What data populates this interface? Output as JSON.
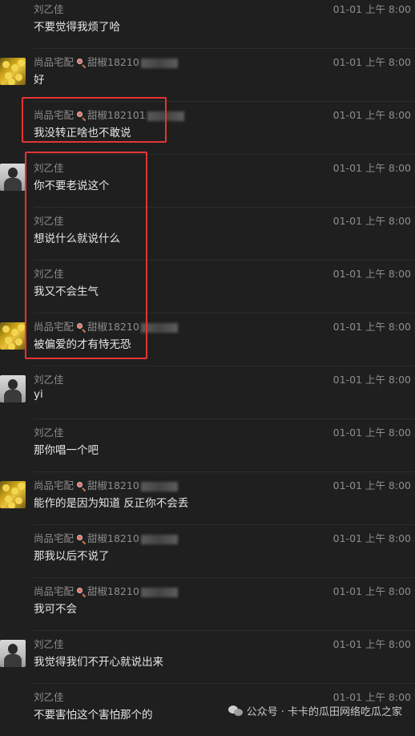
{
  "time_label": "01-01 上午 8:00",
  "messages": [
    {
      "sender": "刘乙佳",
      "sender_suffix": "",
      "text": "不要觉得我烦了哈",
      "avatar": ""
    },
    {
      "sender": "尚品宅配",
      "sender_suffix": "甜椒18210",
      "text": "好",
      "avatar": "flower"
    },
    {
      "sender": "尚品宅配",
      "sender_suffix": "甜椒182101",
      "text": "我没转正啥也不敢说",
      "avatar": ""
    },
    {
      "sender": "刘乙佳",
      "sender_suffix": "",
      "text": "你不要老说这个",
      "avatar": "person"
    },
    {
      "sender": "刘乙佳",
      "sender_suffix": "",
      "text": "想说什么就说什么",
      "avatar": ""
    },
    {
      "sender": "刘乙佳",
      "sender_suffix": "",
      "text": "我又不会生气",
      "avatar": ""
    },
    {
      "sender": "尚品宅配",
      "sender_suffix": "甜椒18210",
      "text": "被偏爱的才有恃无恐",
      "avatar": "flower"
    },
    {
      "sender": "刘乙佳",
      "sender_suffix": "",
      "text": "yi",
      "avatar": "person"
    },
    {
      "sender": "刘乙佳",
      "sender_suffix": "",
      "text": "那你唱一个吧",
      "avatar": ""
    },
    {
      "sender": "尚品宅配",
      "sender_suffix": "甜椒18210",
      "text": "能作的是因为知道 反正你不会丢",
      "avatar": "flower"
    },
    {
      "sender": "尚品宅配",
      "sender_suffix": "甜椒18210",
      "text": "那我以后不说了",
      "avatar": ""
    },
    {
      "sender": "尚品宅配",
      "sender_suffix": "甜椒18210",
      "text": "我可不会",
      "avatar": ""
    },
    {
      "sender": "刘乙佳",
      "sender_suffix": "",
      "text": "我觉得我们不开心就说出来",
      "avatar": "person"
    },
    {
      "sender": "刘乙佳",
      "sender_suffix": "",
      "text": "不要害怕这个害怕那个的",
      "avatar": ""
    }
  ],
  "watermark": {
    "text": "公众号 · 卡卡的瓜田网络吃瓜之家"
  },
  "colors": {
    "highlight": "#e53434",
    "background": "#1f1f1f"
  }
}
